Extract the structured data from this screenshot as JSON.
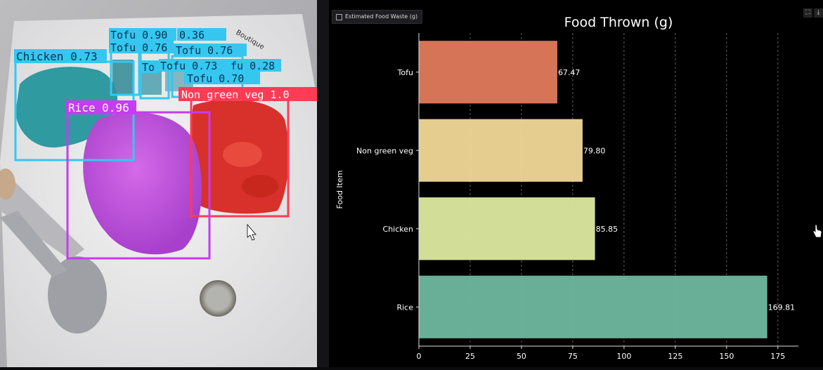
{
  "app": {
    "tab_title": "Estimated Food Waste (g)",
    "icons": {
      "tab": "chart-icon",
      "fullscreen": "fullscreen-icon",
      "download": "download-icon"
    }
  },
  "photo": {
    "detections": [
      {
        "label": "Chicken 0.73",
        "color": "#35c7f0"
      },
      {
        "label": "Tofu 0.90",
        "color": "#35c7f0"
      },
      {
        "label": "0.36",
        "color": "#35c7f0"
      },
      {
        "label": "Tofu 0.76",
        "color": "#35c7f0"
      },
      {
        "label": "Tofu 0.76",
        "color": "#35c7f0"
      },
      {
        "label": "To",
        "color": "#35c7f0"
      },
      {
        "label": "Tofu 0.73",
        "color": "#35c7f0"
      },
      {
        "label": "fu 0.28",
        "color": "#35c7f0"
      },
      {
        "label": "Tofu 0.70",
        "color": "#35c7f0"
      },
      {
        "label": "Non green veg 1.0",
        "color": "#ff3b55"
      },
      {
        "label": "Rice 0.96",
        "color": "#c63cf0"
      }
    ],
    "plate_text": "Boutique"
  },
  "chart_data": {
    "type": "bar",
    "orientation": "horizontal",
    "title": "Food Thrown (g)",
    "ylabel": "Food Item",
    "xlabel": "",
    "categories": [
      "Tofu",
      "Non green veg",
      "Chicken",
      "Rice"
    ],
    "values": [
      67.47,
      79.8,
      85.85,
      169.81
    ],
    "value_labels": [
      "67.47",
      "79.80",
      "85.85",
      "169.81"
    ],
    "colors": [
      "#e27a5c",
      "#f1d898",
      "#dde9a0",
      "#6fb8a0"
    ],
    "xlim": [
      0,
      185
    ],
    "xticks": [
      0,
      25,
      50,
      75,
      100,
      125,
      150,
      175
    ],
    "grid": "vertical dashed",
    "background": "#000000"
  }
}
